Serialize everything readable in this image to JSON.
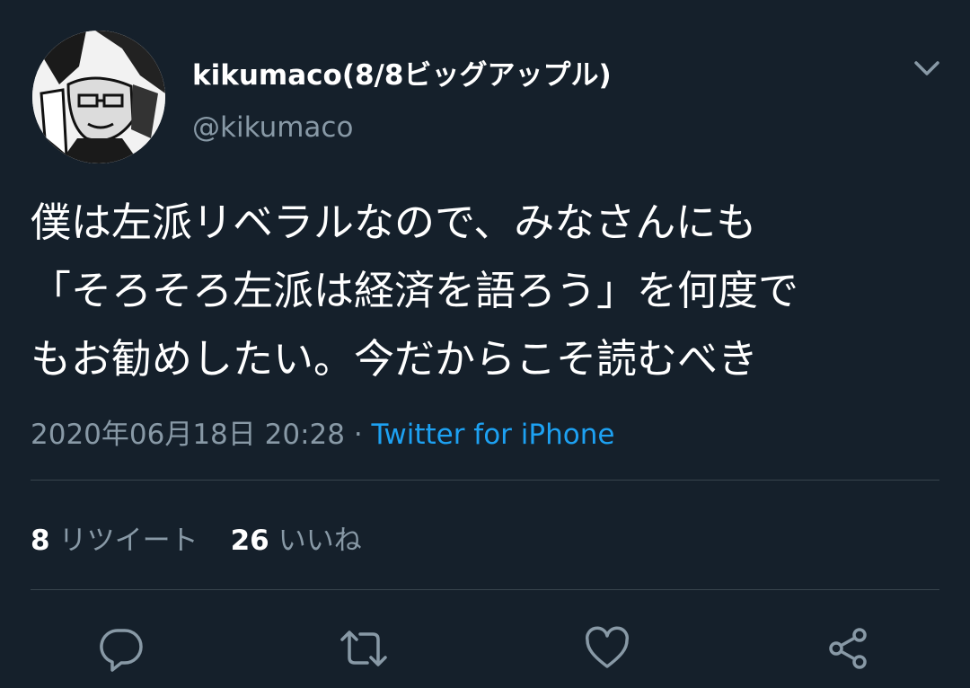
{
  "user": {
    "display_name": "kikumaco(8/8ビッグアップル)",
    "handle": "@kikumaco",
    "avatar_icon": "user-avatar-manga-portrait"
  },
  "menu": {
    "icon": "chevron-down-icon"
  },
  "tweet": {
    "lines": [
      "僕は左派リベラルなので、みなさんにも",
      "「そろそろ左派は経済を語ろう」を何度で",
      "もお勧めしたい。今だからこそ読むべき"
    ],
    "timestamp": "2020年06月18日 20:28",
    "separator": " · ",
    "source": "Twitter for iPhone"
  },
  "stats": {
    "retweets_count": "8",
    "retweets_label": "リツイート",
    "likes_count": "26",
    "likes_label": "いいね"
  },
  "actions": [
    {
      "name": "reply",
      "icon": "reply-icon"
    },
    {
      "name": "retweet",
      "icon": "retweet-icon"
    },
    {
      "name": "like",
      "icon": "heart-icon"
    },
    {
      "name": "share",
      "icon": "share-icon"
    }
  ],
  "colors": {
    "background": "#15202b",
    "primary_text": "#ffffff",
    "secondary_text": "#8899a6",
    "link": "#1da1f2",
    "divider": "#38444d"
  }
}
